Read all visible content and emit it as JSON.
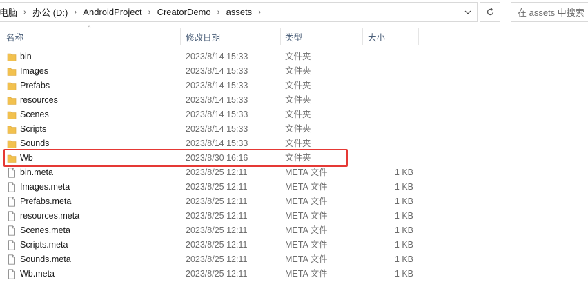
{
  "address": {
    "crumbs": [
      "电脑",
      "办公 (D:)",
      "AndroidProject",
      "CreatorDemo",
      "assets"
    ]
  },
  "search": {
    "placeholder": "在 assets 中搜索"
  },
  "columns": {
    "name": "名称",
    "date": "修改日期",
    "type": "类型",
    "size": "大小"
  },
  "folders": [
    {
      "name": "bin",
      "date": "2023/8/14 15:33",
      "type": "文件夹"
    },
    {
      "name": "Images",
      "date": "2023/8/14 15:33",
      "type": "文件夹"
    },
    {
      "name": "Prefabs",
      "date": "2023/8/14 15:33",
      "type": "文件夹"
    },
    {
      "name": "resources",
      "date": "2023/8/14 15:33",
      "type": "文件夹"
    },
    {
      "name": "Scenes",
      "date": "2023/8/14 15:33",
      "type": "文件夹"
    },
    {
      "name": "Scripts",
      "date": "2023/8/14 15:33",
      "type": "文件夹"
    },
    {
      "name": "Sounds",
      "date": "2023/8/14 15:33",
      "type": "文件夹"
    },
    {
      "name": "Wb",
      "date": "2023/8/30 16:16",
      "type": "文件夹"
    }
  ],
  "files": [
    {
      "name": "bin.meta",
      "date": "2023/8/25 12:11",
      "type": "META 文件",
      "size": "1 KB"
    },
    {
      "name": "Images.meta",
      "date": "2023/8/25 12:11",
      "type": "META 文件",
      "size": "1 KB"
    },
    {
      "name": "Prefabs.meta",
      "date": "2023/8/25 12:11",
      "type": "META 文件",
      "size": "1 KB"
    },
    {
      "name": "resources.meta",
      "date": "2023/8/25 12:11",
      "type": "META 文件",
      "size": "1 KB"
    },
    {
      "name": "Scenes.meta",
      "date": "2023/8/25 12:11",
      "type": "META 文件",
      "size": "1 KB"
    },
    {
      "name": "Scripts.meta",
      "date": "2023/8/25 12:11",
      "type": "META 文件",
      "size": "1 KB"
    },
    {
      "name": "Sounds.meta",
      "date": "2023/8/25 12:11",
      "type": "META 文件",
      "size": "1 KB"
    },
    {
      "name": "Wb.meta",
      "date": "2023/8/25 12:11",
      "type": "META 文件",
      "size": "1 KB"
    }
  ],
  "colors": {
    "folder": "#f2c14e",
    "highlight_box": "#e53935",
    "header_text": "#4c607a"
  }
}
